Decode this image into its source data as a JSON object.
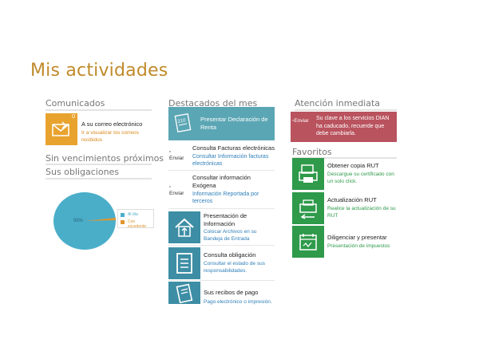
{
  "page": {
    "title": "Mis actividades"
  },
  "comunicados": {
    "title": "Comunicados",
    "badge": "0",
    "item_title": "A su correo electrónico",
    "item_sub": "Ir a visualizar los correos recibidos"
  },
  "vencimientos": {
    "title": "Sin vencimientos próximos"
  },
  "obligaciones": {
    "title": "Sus obligaciones",
    "pie_center": "98%",
    "legend": [
      {
        "label": "Al día",
        "color": "#4aaec9"
      },
      {
        "label": "Con excedente",
        "color": "#e0962e"
      }
    ]
  },
  "destacados": {
    "title": "Destacados del mes",
    "items": [
      {
        "title": "Presentar Declaración de Renta",
        "sub": ""
      },
      {
        "title": "Consulta Facturas electrónicas",
        "sub": "Consultar Información facturas electrónicas",
        "alt": "Enviar"
      },
      {
        "title": "Consultar información Exógena",
        "sub": "Información Reportada por terceros",
        "alt": "Enviar"
      },
      {
        "title": "Presentación de Información",
        "sub": "Colocar Archivos en su Bandeja de Entrada"
      },
      {
        "title": "Consulta obligación",
        "sub": "Consultar el estado de sus responsabilidades."
      },
      {
        "title": "Sus recibos de pago",
        "sub": "Pago electrónico o impresión."
      }
    ]
  },
  "atencion": {
    "title": "Atención inmediata",
    "alt": "Enviar",
    "message": "Su clave a los servicios DIAN ha caducado, recuerde que debe cambiarla."
  },
  "favoritos": {
    "title": "Favoritos",
    "items": [
      {
        "title": "Obtener copia RUT",
        "sub": "Descargue su certificado con un solo click."
      },
      {
        "title": "Actualización RUT",
        "sub": "Realice la actualización de su RUT"
      },
      {
        "title": "Diligenciar y presentar",
        "sub": "Presentación de impuestos"
      }
    ]
  },
  "colors": {
    "accent": "#c08a2a",
    "teal": "#3d8ea5",
    "green": "#2e9a4a",
    "red": "#b9535e",
    "orange": "#e0962e"
  }
}
